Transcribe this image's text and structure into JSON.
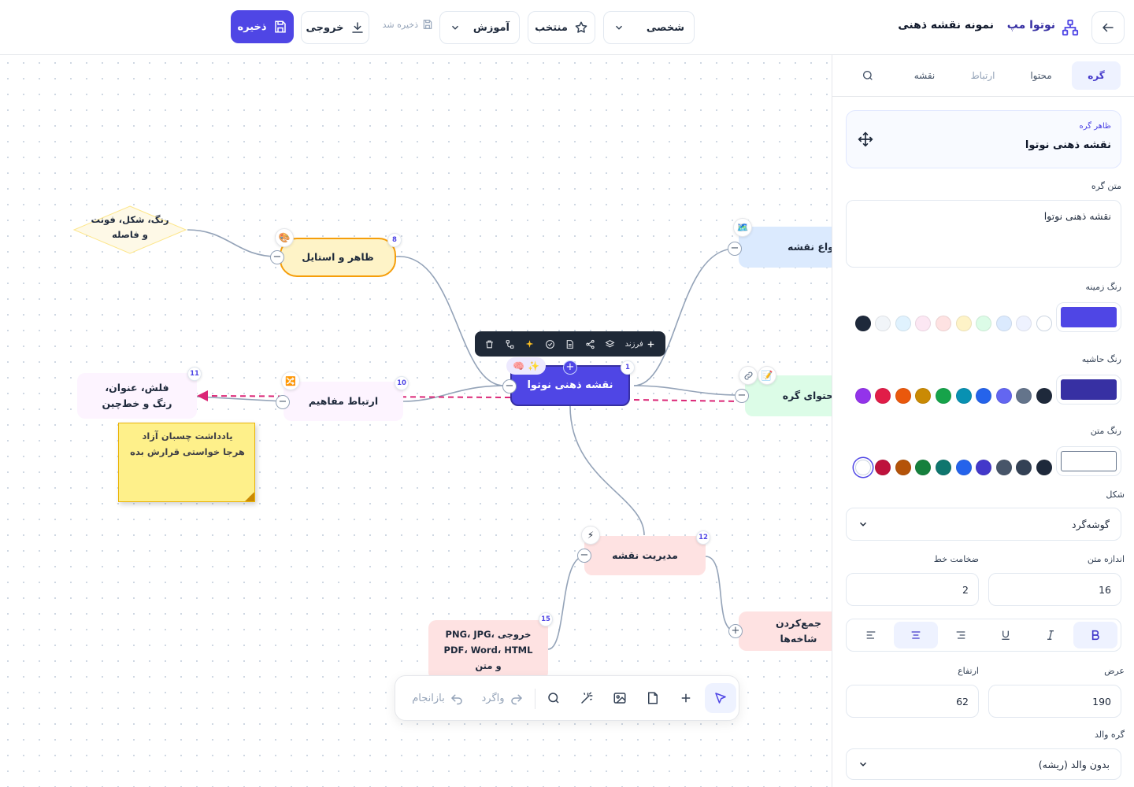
{
  "header": {
    "brand": "نوتوا مپ",
    "map_title": "نمونه نقشه ذهنی",
    "workspace_select": "شخصی",
    "favorite_label": "منتخب",
    "tutorial_select": "آموزش",
    "saved_status": "ذخیره شد",
    "export_label": "خروجی",
    "save_label": "ذخیره"
  },
  "nodes": {
    "root": {
      "label": "نقشه ذهنی نوتوا",
      "badge": "1"
    },
    "appearance": {
      "label": "ظاهر و استایل",
      "badge": "8",
      "emoji": "🎨"
    },
    "appearance_child": {
      "label": "رنگ، شکل، فونت و فاصله"
    },
    "relations": {
      "label": "ارتباط مفاهیم",
      "badge": "10",
      "emoji": "🔀"
    },
    "arrow_note": {
      "label": "فلش، عنوان، رنگ و خط‌چین",
      "badge": "11"
    },
    "sticky": {
      "label": "یادداشت چسبان آزاد\\nهرجا خواستی قرارش بده"
    },
    "map_types": {
      "label": "انواع نقشه",
      "emoji": "🗺️"
    },
    "content": {
      "label": "محتوای گره",
      "emoji": "📝"
    },
    "management": {
      "label": "مدیریت نقشه",
      "badge": "12",
      "emoji": "⚡"
    },
    "export": {
      "label": "خروجی PNG، JPG، PDF، Word، HTML و متن",
      "badge": "15"
    },
    "collapse": {
      "label": "جمع‌کردن شاخه‌ها"
    }
  },
  "node_toolbar": {
    "child_label": "فرزند"
  },
  "bottom_toolbar": {
    "undo_label": "واگرد",
    "redo_label": "بازانجام"
  },
  "panel": {
    "tabs": [
      "گره",
      "محتوا",
      "ارتباط",
      "نقشه"
    ],
    "card_caption": "ظاهر گره",
    "card_title": "نقشه ذهنی نوتوا",
    "text_label": "متن گره",
    "text_value": "نقشه ذهنی نوتوا",
    "bg_label": "رنگ زمینه",
    "border_label": "رنگ حاشیه",
    "textcolor_label": "رنگ متن",
    "shape_label": "شکل",
    "shape_value": "گوشه‌گرد",
    "fontsize_label": "اندازه متن",
    "fontsize_value": "16",
    "linewidth_label": "ضخامت خط",
    "linewidth_value": "2",
    "width_label": "عرض",
    "width_value": "190",
    "height_label": "ارتفاع",
    "height_value": "62",
    "parent_label": "گره والد",
    "parent_value": "بدون والد (ریشه)",
    "colors": {
      "bg_current": "#4f46e5",
      "border_current": "#3730a3",
      "text_current": "#ffffff",
      "bg_swatches": [
        "#ffffff",
        "#eef2ff",
        "#dbeafe",
        "#dcfce7",
        "#fef3c7",
        "#fee2e2",
        "#fce7f3",
        "#e0f2fe",
        "#f1f5f9",
        "#1e293b"
      ],
      "border_swatches": [
        "#1e293b",
        "#64748b",
        "#6366f1",
        "#2563eb",
        "#0891b2",
        "#16a34a",
        "#ca8a04",
        "#ea580c",
        "#e11d48",
        "#9333ea"
      ],
      "text_swatches": [
        "#1e293b",
        "#334155",
        "#475569",
        "#4338ca",
        "#2563eb",
        "#0f766e",
        "#15803d",
        "#b45309",
        "#be123c",
        "#ffffff"
      ]
    }
  }
}
